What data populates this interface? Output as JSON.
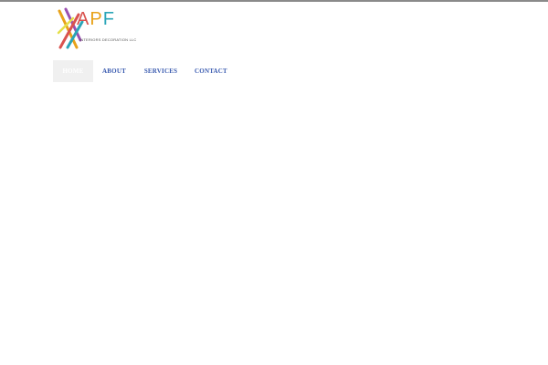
{
  "logo": {
    "letters": [
      "A",
      "P",
      "F"
    ],
    "letter_colors": [
      "#d9534f",
      "#e8a21a",
      "#2aa5b8"
    ],
    "tagline": "INTERIORS DECORATION LLC"
  },
  "nav": {
    "items": [
      {
        "label": "HOME",
        "active": true
      },
      {
        "label": "ABOUT",
        "active": false
      },
      {
        "label": "SERVICES",
        "active": false
      },
      {
        "label": "CONTACT",
        "active": false
      }
    ]
  },
  "colors": {
    "nav_link": "#3a5bb0",
    "nav_active_bg": "#f0f0f0",
    "top_rule": "#8a8a8a"
  }
}
